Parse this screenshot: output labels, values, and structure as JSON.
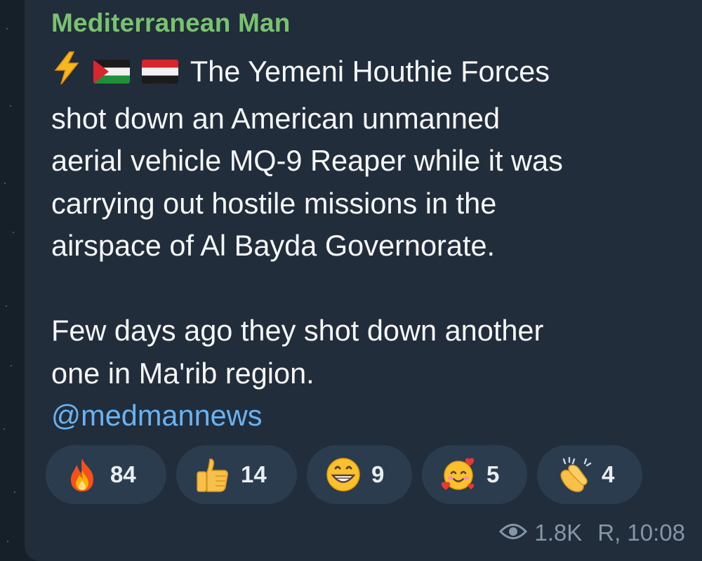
{
  "message": {
    "sender": "Mediterranean Man",
    "lines": [
      "The Yemeni Houthie Forces",
      "shot down an American unmanned",
      "aerial vehicle MQ-9 Reaper while it was",
      "carrying out hostile missions in the",
      "airspace of Al Bayda Governorate."
    ],
    "lines2": [
      "Few days ago they shot down another",
      "one in Ma'rib region."
    ],
    "link": "@medmannews",
    "leading_icons": [
      "high-voltage-icon",
      "palestine-flag-icon",
      "yemen-flag-icon"
    ]
  },
  "reactions": [
    {
      "emoji": "fire-icon",
      "count": "84"
    },
    {
      "emoji": "thumbs-up-icon",
      "count": "14"
    },
    {
      "emoji": "grinning-face-icon",
      "count": "9"
    },
    {
      "emoji": "smiling-face-with-hearts-icon",
      "count": "5"
    },
    {
      "emoji": "clapping-hands-icon",
      "count": "4"
    }
  ],
  "meta": {
    "views": "1.8K",
    "signature_time": "R, 10:08"
  },
  "colors": {
    "sender": "#78c270",
    "link": "#6ab3f3",
    "bubble": "#212d3b",
    "reaction_pill": "#2c3c4f"
  }
}
